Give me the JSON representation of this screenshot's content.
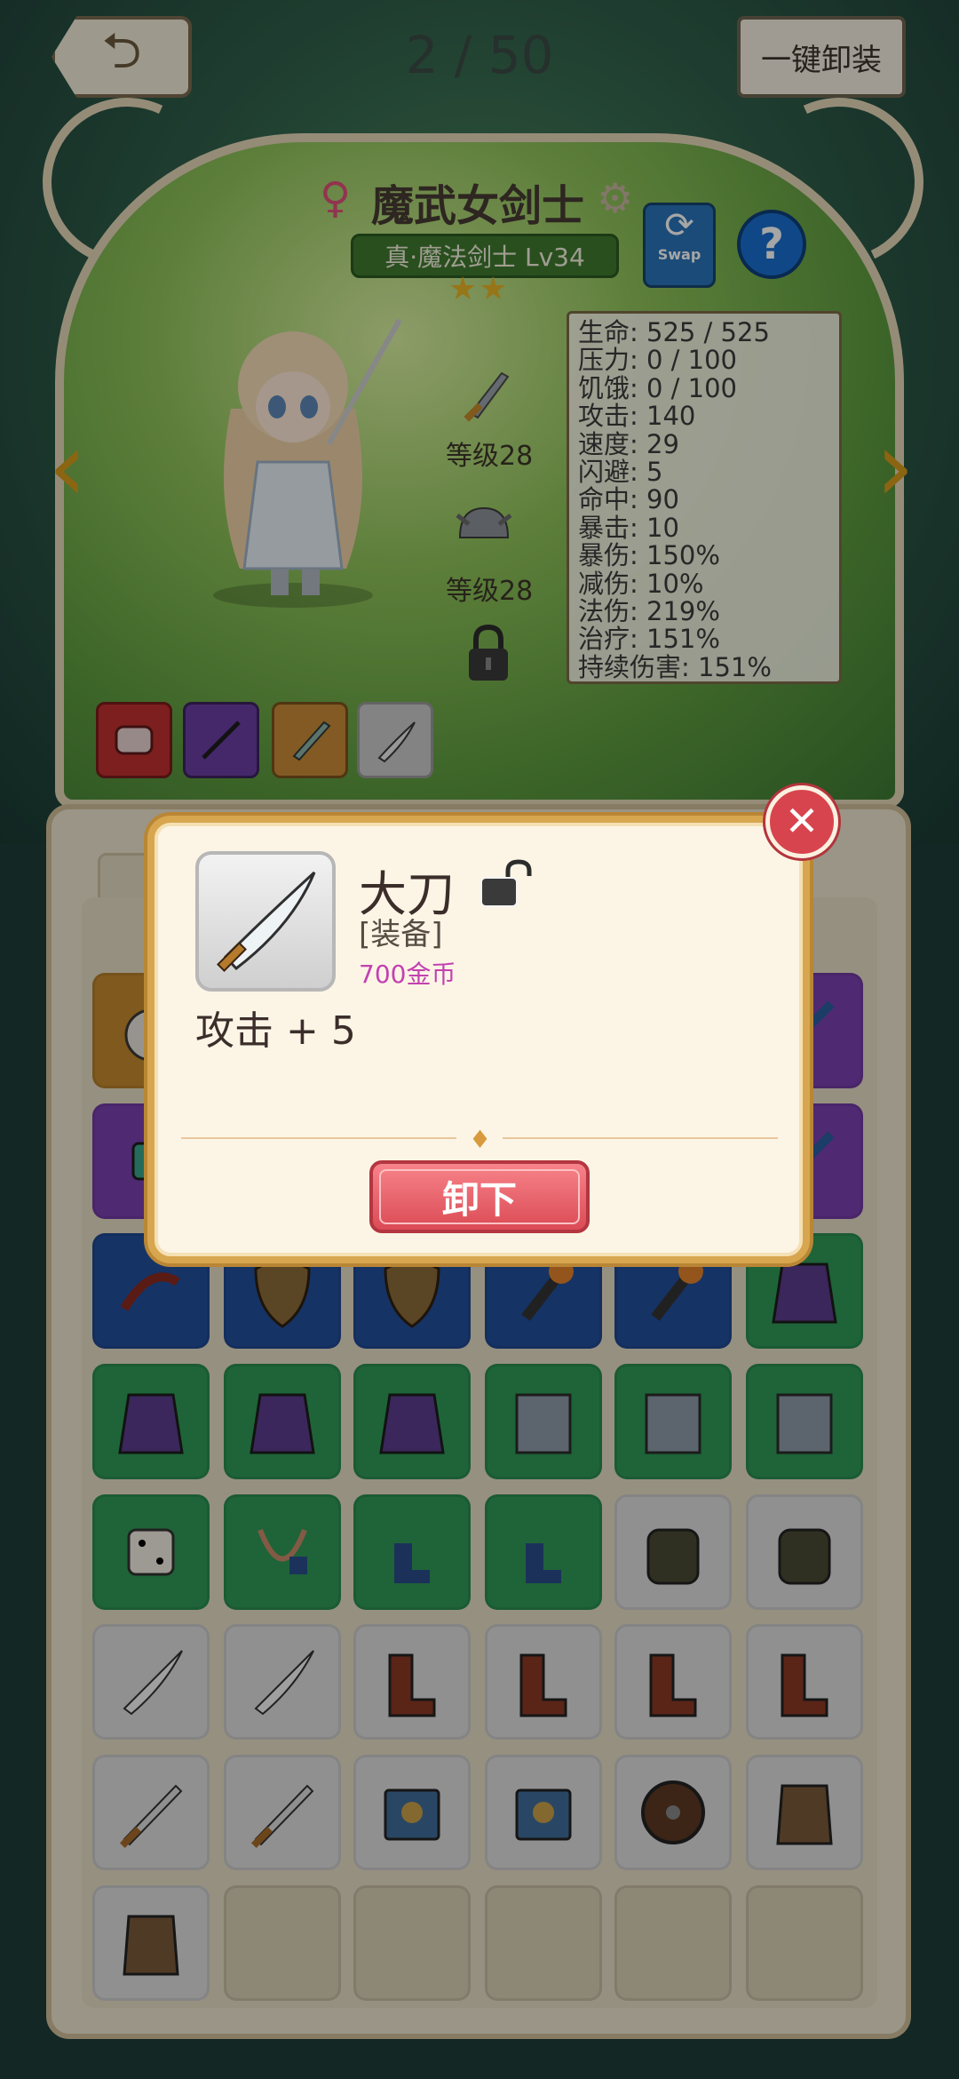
{
  "header": {
    "counter": "2 / 50",
    "unequip_all_label": "一键卸装"
  },
  "character": {
    "name": "魔武女剑士",
    "class_label": "真·魔法剑士 Lv34",
    "stars": "★★",
    "swap_label": "Swap",
    "help_label": "?",
    "weapon_level": "等级28",
    "helmet_level": "等级28"
  },
  "stats": [
    "生命: 525 / 525",
    "压力: 0 / 100",
    "饥饿: 0 / 100",
    "攻击: 140",
    "速度: 29",
    "闪避: 5",
    "命中: 90",
    "暴击: 10",
    "暴伤: 150%",
    "减伤: 10%",
    "法伤: 219%",
    "治疗: 151%",
    "持续伤害: 151%"
  ],
  "popup": {
    "item_name": "大刀",
    "category": "[装备]",
    "price": "700金币",
    "stat": "攻击 + 5",
    "unload_label": "卸下",
    "close_label": "✕"
  },
  "colors": {
    "accent_gold": "#d7a64f",
    "button_red": "#db4b55",
    "price_magenta": "#c341b0"
  }
}
